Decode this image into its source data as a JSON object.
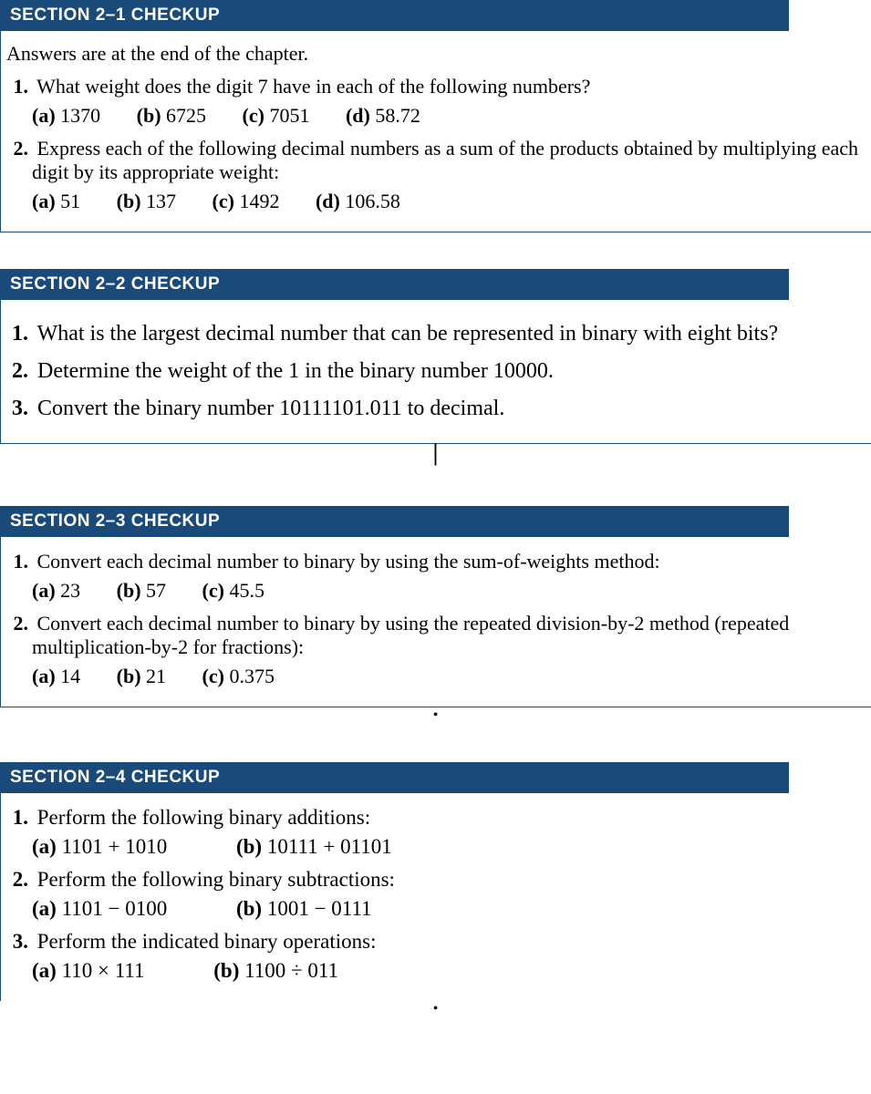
{
  "sections": [
    {
      "header": "SECTION 2–1  CHECKUP",
      "note": "Answers are at the end of the chapter.",
      "questions": [
        {
          "num": "1.",
          "text": "What weight does the digit 7 have in each of the following numbers?",
          "options": [
            {
              "label": "(a)",
              "value": "1370"
            },
            {
              "label": "(b)",
              "value": "6725"
            },
            {
              "label": "(c)",
              "value": "7051"
            },
            {
              "label": "(d)",
              "value": "58.72"
            }
          ]
        },
        {
          "num": "2.",
          "text": "Express each of the following decimal numbers as a sum of the products obtained by multiplying each digit by its appropriate weight:",
          "options": [
            {
              "label": "(a)",
              "value": "51"
            },
            {
              "label": "(b)",
              "value": "137"
            },
            {
              "label": "(c)",
              "value": "1492"
            },
            {
              "label": "(d)",
              "value": "106.58"
            }
          ]
        }
      ]
    },
    {
      "header": "SECTION 2–2  CHECKUP",
      "questions": [
        {
          "num": "1.",
          "text": "What is the largest decimal number that can be represented in binary with eight bits?"
        },
        {
          "num": "2.",
          "text": "Determine the weight of the 1 in the binary number 10000."
        },
        {
          "num": "3.",
          "text": "Convert the binary number 10111101.011 to decimal."
        }
      ]
    },
    {
      "header": "SECTION 2–3  CHECKUP",
      "questions": [
        {
          "num": "1.",
          "text": "Convert each decimal number to binary by using the sum-of-weights method:",
          "options": [
            {
              "label": "(a)",
              "value": "23"
            },
            {
              "label": "(b)",
              "value": "57"
            },
            {
              "label": "(c)",
              "value": "45.5"
            }
          ]
        },
        {
          "num": "2.",
          "text": "Convert each decimal number to binary by using the repeated division-by-2 method (repeated multiplication-by-2 for fractions):",
          "options": [
            {
              "label": "(a)",
              "value": "14"
            },
            {
              "label": "(b)",
              "value": "21"
            },
            {
              "label": "(c)",
              "value": "0.375"
            }
          ]
        }
      ]
    },
    {
      "header": "SECTION 2–4  CHECKUP",
      "questions": [
        {
          "num": "1.",
          "text": "Perform the following binary additions:",
          "options": [
            {
              "label": "(a)",
              "value": "1101 + 1010"
            },
            {
              "label": "(b)",
              "value": "10111 + 01101"
            }
          ],
          "wide": true
        },
        {
          "num": "2.",
          "text": "Perform the following binary subtractions:",
          "options": [
            {
              "label": "(a)",
              "value": "1101 − 0100"
            },
            {
              "label": "(b)",
              "value": "1001 − 0111"
            }
          ],
          "wide": true
        },
        {
          "num": "3.",
          "text": "Perform the indicated binary operations:",
          "options": [
            {
              "label": "(a)",
              "value": "110 × 111"
            },
            {
              "label": "(b)",
              "value": "1100 ÷ 011"
            }
          ],
          "wide": true
        }
      ]
    }
  ]
}
